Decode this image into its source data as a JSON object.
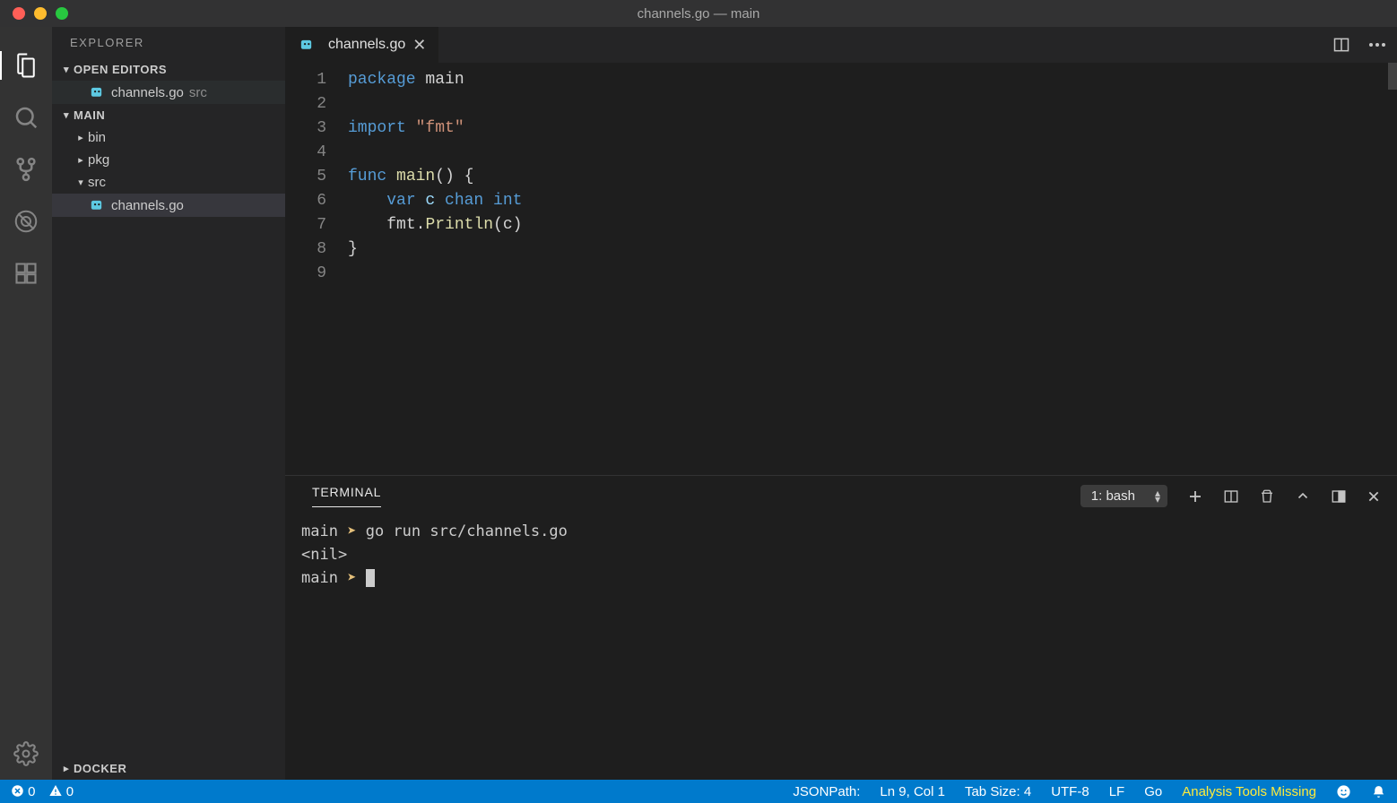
{
  "window": {
    "title": "channels.go — main"
  },
  "sidebar": {
    "title": "EXPLORER",
    "openEditors": {
      "label": "OPEN EDITORS"
    },
    "openFile": {
      "name": "channels.go",
      "dir": "src"
    },
    "workspace": {
      "label": "MAIN"
    },
    "tree": {
      "bin": "bin",
      "pkg": "pkg",
      "src": "src",
      "file": "channels.go"
    },
    "docker": "DOCKER"
  },
  "tab": {
    "name": "channels.go"
  },
  "code": {
    "lines": [
      "1",
      "2",
      "3",
      "4",
      "5",
      "6",
      "7",
      "8",
      "9"
    ],
    "l1_kw": "package",
    "l1_name": " main",
    "l3_kw": "import",
    "l3_str": " \"fmt\"",
    "l5_kw": "func",
    "l5_fn": " main",
    "l5_rest": "() {",
    "l6_kw": "var",
    "l6_id": " c ",
    "l6_chan": "chan",
    "l6_type": " int",
    "l7_pkg": "fmt",
    "l7_dot": ".",
    "l7_fn": "Println",
    "l7_args": "(c)",
    "l8": "}"
  },
  "terminal": {
    "tab": "TERMINAL",
    "select": "1: bash",
    "line1_dir": "main",
    "line1_cmd": " go run src/channels.go",
    "line2": "<nil>",
    "line3_dir": "main"
  },
  "status": {
    "errors": "0",
    "warnings": "0",
    "jsonpath": "JSONPath:",
    "position": "Ln 9, Col 1",
    "tabsize": "Tab Size: 4",
    "encoding": "UTF-8",
    "eol": "LF",
    "lang": "Go",
    "analysis": "Analysis Tools Missing"
  }
}
